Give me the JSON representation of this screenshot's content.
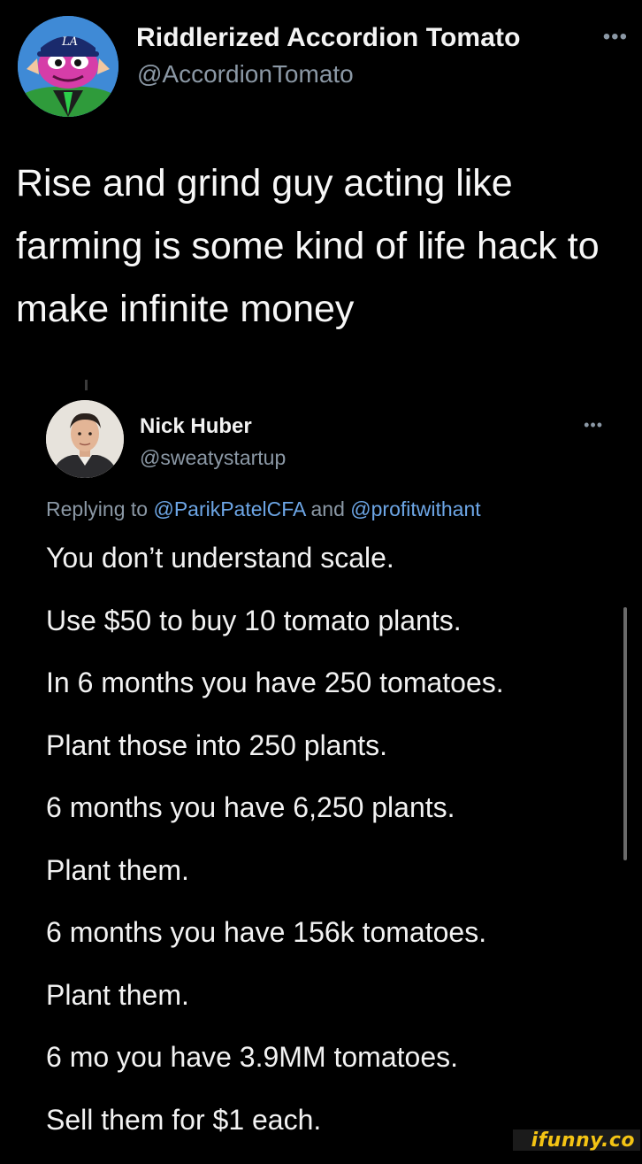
{
  "main_tweet": {
    "author_name": "Riddlerized Accordion Tomato",
    "author_handle": "@AccordionTomato",
    "more_label": "•••",
    "text": "Rise and grind guy acting like farming is some kind of life hack to make infinite money"
  },
  "quoted_tweet": {
    "author_name": "Nick Huber",
    "author_handle": "@sweatystartup",
    "more_label": "•••",
    "replying_prefix": "Replying to",
    "replying_mention_1": "@ParikPatelCFA",
    "replying_and": "and",
    "replying_mention_2": "@profitwithant",
    "lines": [
      "You don’t understand scale.",
      "Use $50 to buy 10 tomato plants.",
      "In 6 months you have 250 tomatoes.",
      "Plant those into 250 plants.",
      "6 months you have 6,250 plants.",
      "Plant them.",
      "6 months you have 156k tomatoes.",
      "Plant them.",
      "6 mo you have 3.9MM tomatoes.",
      "Sell them for $1 each."
    ]
  },
  "watermark": "ifunny.co",
  "colors": {
    "background": "#000000",
    "text": "#f7f7f7",
    "muted": "#8b98a5",
    "link": "#6da6e6",
    "watermark": "#f4c414"
  },
  "icons": {
    "main_avatar": "cartoon-frog-avatar",
    "quoted_avatar": "person-photo-avatar",
    "more": "more-horizontal-icon"
  }
}
